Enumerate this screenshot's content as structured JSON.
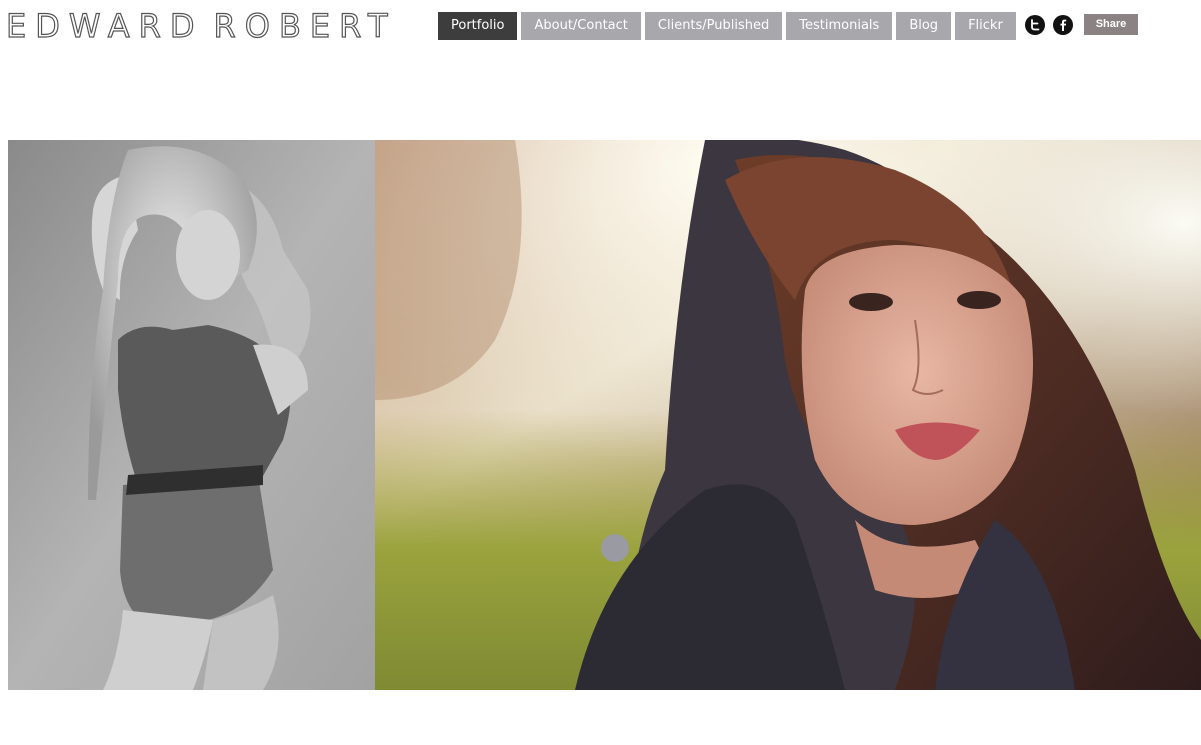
{
  "site": {
    "logo_text": [
      "EDWARD",
      "ROBERT"
    ]
  },
  "nav": {
    "items": [
      {
        "label": "Portfolio",
        "active": true
      },
      {
        "label": "About/Contact",
        "active": false
      },
      {
        "label": "Clients/Published",
        "active": false
      },
      {
        "label": "Testimonials",
        "active": false
      },
      {
        "label": "Blog",
        "active": false
      },
      {
        "label": "Flickr",
        "active": false
      }
    ]
  },
  "social": {
    "icons": [
      "twitter-icon",
      "facebook-icon"
    ]
  },
  "share": {
    "label": "Share"
  },
  "gallery": {
    "images": [
      "bw-model-photo",
      "hooded-woman-photo"
    ]
  },
  "colors": {
    "nav_inactive": "#a7a7ac",
    "nav_active": "#3d3d3d",
    "share_button": "#8a8283"
  }
}
